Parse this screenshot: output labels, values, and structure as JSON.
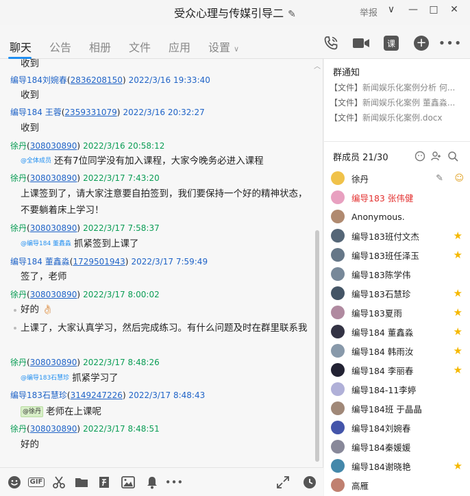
{
  "window": {
    "title": "受众心理与传媒引导二",
    "report_label": "举报",
    "minimize": "—",
    "maximize": "□",
    "close": "✕",
    "dropdown": "∨"
  },
  "tabs": [
    {
      "label": "聊天",
      "active": true
    },
    {
      "label": "公告"
    },
    {
      "label": "相册"
    },
    {
      "label": "文件"
    },
    {
      "label": "应用"
    },
    {
      "label": "设置"
    }
  ],
  "toolbar_icons": {
    "call": "phone-icon",
    "video": "video-icon",
    "course": "课",
    "add": "+",
    "more": "•••"
  },
  "messages": [
    {
      "type": "body",
      "text": "收到"
    },
    {
      "type": "head",
      "name": "编导184刘婉春",
      "uid": "2836208150",
      "time": "2022/3/16 19:33:40"
    },
    {
      "type": "body",
      "text": "收到"
    },
    {
      "type": "head",
      "name": "编导184 王蓉",
      "uid": "2359331079",
      "time": "2022/3/16 20:32:27"
    },
    {
      "type": "body",
      "text": "收到"
    },
    {
      "type": "head",
      "name": "徐丹",
      "uid": "308030890",
      "time": "2022/3/16 20:58:12"
    },
    {
      "type": "body",
      "mention": "@全体成员",
      "text": "还有7位同学没有加入课程，大家今晚务必进入课程"
    },
    {
      "type": "head",
      "name": "徐丹",
      "uid": "308030890",
      "time": "2022/3/17 7:43:20"
    },
    {
      "type": "body",
      "text": "上课签到了，请大家注意要自拍签到，我们要保持一个好的精神状态，不要躺着床上学习！"
    },
    {
      "type": "head",
      "name": "徐丹",
      "uid": "308030890",
      "time": "2022/3/17 7:58:37"
    },
    {
      "type": "body",
      "mention": "@编导184 董鑫淼",
      "text": "抓紧签到上课了"
    },
    {
      "type": "head",
      "name": "编导184 董鑫淼",
      "uid": "1729501943",
      "time": "2022/3/17 7:59:49"
    },
    {
      "type": "body",
      "text": "签了，老师"
    },
    {
      "type": "head",
      "name": "徐丹",
      "uid": "308030890",
      "time": "2022/3/17 8:00:02"
    },
    {
      "type": "body",
      "text": "好的",
      "emoji": "👌🏻"
    },
    {
      "type": "body",
      "text": "上课了，大家认真学习，然后完成练习。有什么问题及时在群里联系我"
    },
    {
      "type": "head",
      "name": "徐丹",
      "uid": "308030890",
      "time": "2022/3/17 8:48:26"
    },
    {
      "type": "body",
      "mention": "@编导183石慧珍",
      "text": "抓紧学习了"
    },
    {
      "type": "head",
      "name": "编导183石慧珍",
      "uid": "3149247226",
      "time": "2022/3/17 8:48:43"
    },
    {
      "type": "body",
      "mention_tag": "@徐丹",
      "text": "老师在上课呢"
    },
    {
      "type": "head",
      "name": "徐丹",
      "uid": "308030890",
      "time": "2022/3/17 8:48:51"
    },
    {
      "type": "body",
      "text": "好的"
    }
  ],
  "bottom_tools": [
    "emoji-icon",
    "GIF",
    "scissors-icon",
    "folder-icon",
    "doc-icon",
    "image-icon",
    "bell-icon",
    "•••",
    "expand-icon",
    "history-icon"
  ],
  "notice": {
    "title": "群通知",
    "items": [
      {
        "tag": "【文件】",
        "text": "新闻娱乐化案例分析  何..."
      },
      {
        "tag": "【文件】",
        "text": "新闻娱乐化案例 董鑫淼..."
      },
      {
        "tag": "【文件】",
        "text": "新闻娱乐化案例.docx"
      }
    ]
  },
  "members": {
    "title": "群成员 21/30",
    "list": [
      {
        "name": "徐丹",
        "color": "#f0c24a",
        "owner": true
      },
      {
        "name": "编导183 张伟健",
        "color": "#e8a0c0",
        "red": true
      },
      {
        "name": "Anonymous.",
        "color": "#b08a70"
      },
      {
        "name": "编导183班付文杰",
        "color": "#556677",
        "star": true
      },
      {
        "name": "编导183班任泽玉",
        "color": "#667788",
        "star": true
      },
      {
        "name": "编导183陈学伟",
        "color": "#778899"
      },
      {
        "name": "编导183石慧珍",
        "color": "#445566",
        "star": true
      },
      {
        "name": "编导183夏雨",
        "color": "#b08aa0",
        "star": true
      },
      {
        "name": "编导184 董鑫淼",
        "color": "#333344",
        "star": true
      },
      {
        "name": "编导184 韩雨汝",
        "color": "#8899aa",
        "star": true
      },
      {
        "name": "编导184 李丽春",
        "color": "#222233",
        "star": true
      },
      {
        "name": "编导184-11李婷",
        "color": "#b0b0d8"
      },
      {
        "name": "编导184班  于晶晶",
        "color": "#a08878"
      },
      {
        "name": "编导184刘婉春",
        "color": "#4455aa"
      },
      {
        "name": "编导184秦媛媛",
        "color": "#888899"
      },
      {
        "name": "编导184谢晓艳",
        "color": "#4488aa",
        "star": true
      },
      {
        "name": "高雁",
        "color": "#c08070"
      }
    ]
  }
}
